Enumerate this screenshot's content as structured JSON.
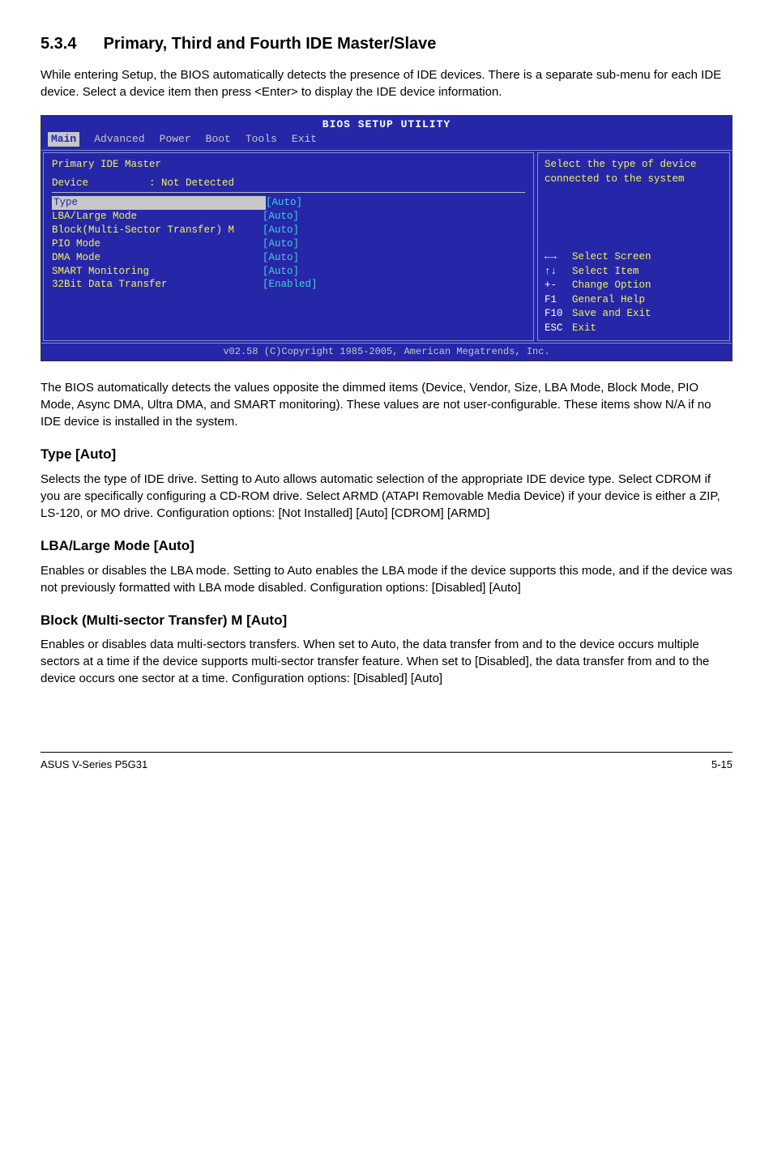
{
  "section": {
    "number": "5.3.4",
    "title": "Primary, Third and Fourth IDE Master/Slave"
  },
  "intro": "While entering Setup, the BIOS automatically detects the presence of IDE devices. There is a separate sub-menu for each IDE device. Select a device item then press <Enter> to display the IDE device information.",
  "bios": {
    "header": "BIOS SETUP UTILITY",
    "menu": [
      "Main",
      "Advanced",
      "Power",
      "Boot",
      "Tools",
      "Exit"
    ],
    "activeMenuIndex": 0,
    "panelTitle": "Primary IDE Master",
    "device": {
      "label": "Device",
      "value": ": Not Detected"
    },
    "rows": [
      {
        "label": "Type",
        "value": "[Auto]",
        "highlight": true
      },
      {
        "label": "LBA/Large Mode",
        "value": "[Auto]"
      },
      {
        "label": "Block(Multi-Sector Transfer) M",
        "value": "[Auto]"
      },
      {
        "label": "PIO Mode",
        "value": "[Auto]"
      },
      {
        "label": "DMA Mode",
        "value": "[Auto]"
      },
      {
        "label": "SMART Monitoring",
        "value": "[Auto]"
      },
      {
        "label": "32Bit Data Transfer",
        "value": "[Enabled]"
      }
    ],
    "help": "Select the type of device connected to the system",
    "legend": [
      {
        "key": "←→",
        "text": "Select Screen"
      },
      {
        "key": "↑↓",
        "text": "Select Item"
      },
      {
        "key": "+-",
        "text": "Change Option"
      },
      {
        "key": "F1",
        "text": "General Help"
      },
      {
        "key": "F10",
        "text": "Save and Exit"
      },
      {
        "key": "ESC",
        "text": "Exit"
      }
    ],
    "footer": "v02.58 (C)Copyright 1985-2005, American Megatrends, Inc."
  },
  "para2": "The BIOS automatically detects the values opposite the dimmed items (Device, Vendor, Size, LBA Mode, Block Mode, PIO Mode, Async DMA, Ultra DMA, and SMART monitoring). These values are not user-configurable. These items show N/A if no IDE device is installed in the system.",
  "type": {
    "heading": "Type [Auto]",
    "body": "Selects the type of IDE drive. Setting to Auto allows automatic selection of the appropriate IDE device type. Select CDROM if you are specifically configuring a CD-ROM drive. Select ARMD (ATAPI Removable Media Device) if your device is either a ZIP, LS-120, or MO drive. Configuration options: [Not Installed] [Auto] [CDROM] [ARMD]"
  },
  "lba": {
    "heading": "LBA/Large Mode [Auto]",
    "body": "Enables or disables the LBA mode. Setting to Auto enables the LBA mode if the device supports this mode, and if the device was not previously formatted with LBA mode disabled. Configuration options: [Disabled] [Auto]"
  },
  "block": {
    "heading": "Block (Multi-sector Transfer) M [Auto]",
    "body": "Enables or disables data multi-sectors transfers. When set to Auto, the data transfer from and to the device occurs multiple sectors at a time if the device supports multi-sector transfer feature. When set to [Disabled], the data transfer from and to the device occurs one sector at a time. Configuration options: [Disabled] [Auto]"
  },
  "footer": {
    "left": "ASUS  V-Series P5G31",
    "right": "5-15"
  }
}
